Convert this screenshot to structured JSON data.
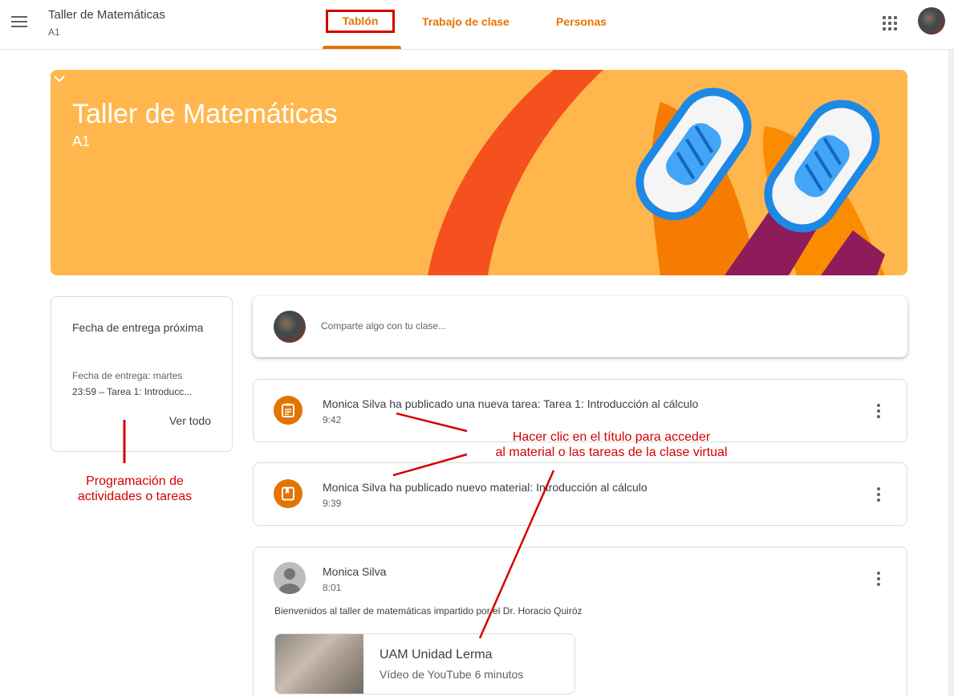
{
  "header": {
    "class_title": "Taller de Matemáticas",
    "class_section": "A1",
    "tabs": [
      {
        "label": "Tablón",
        "active": true
      },
      {
        "label": "Trabajo de clase",
        "active": false
      },
      {
        "label": "Personas",
        "active": false
      }
    ],
    "icons": [
      "menu-icon",
      "apps-grid-icon",
      "account-avatar"
    ]
  },
  "banner": {
    "title": "Taller de Matemáticas",
    "section": "A1",
    "colors": {
      "background": "#ffb74d",
      "accent": "#e37400",
      "arc": "#f4511e"
    }
  },
  "upcoming": {
    "title": "Fecha de entrega próxima",
    "due_label": "Fecha de entrega: martes",
    "due_item": "23:59 – Tarea 1: Introducc...",
    "view_all": "Ver todo"
  },
  "share": {
    "placeholder": "Comparte algo con tu clase..."
  },
  "stream": [
    {
      "type": "assignment",
      "title": "Monica Silva ha publicado una nueva tarea: Tarea 1: Introducción al cálculo",
      "time": "9:42"
    },
    {
      "type": "material",
      "title": "Monica Silva ha publicado nuevo material: Introducción al cálculo",
      "time": "9:39"
    },
    {
      "type": "announcement",
      "author": "Monica Silva",
      "time": "8:01",
      "text": "Bienvenidos al taller de matemáticas impartido por el Dr. Horacio Quiróz",
      "attachment": {
        "title": "UAM Unidad Lerma",
        "meta": "Vídeo de YouTube   6 minutos"
      }
    }
  ],
  "annotations": {
    "left": [
      "Programación de",
      "actividades o tareas"
    ],
    "right": [
      "Hacer clic en el título para acceder",
      "al material o las tareas de la clase virtual"
    ],
    "color": "#d50000"
  }
}
